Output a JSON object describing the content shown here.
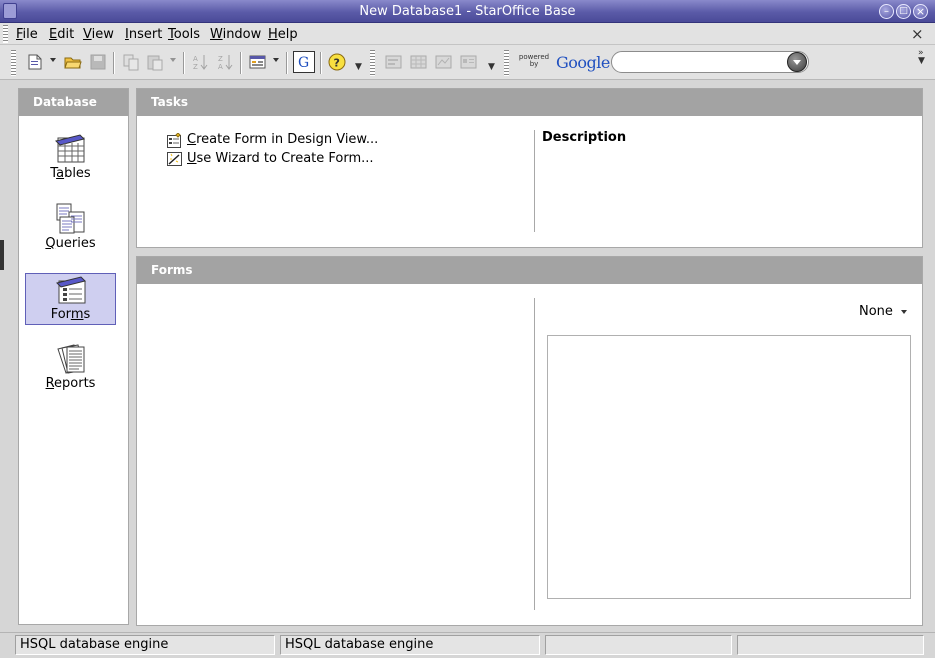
{
  "window": {
    "title": "New Database1 - StarOffice Base"
  },
  "menu": {
    "items": [
      {
        "label": "File",
        "u": "F",
        "rest": "ile"
      },
      {
        "label": "Edit",
        "u": "E",
        "rest": "dit"
      },
      {
        "label": "View",
        "u": "V",
        "rest": "iew"
      },
      {
        "label": "Insert",
        "u": "I",
        "rest": "nsert"
      },
      {
        "label": "Tools",
        "u": "T",
        "rest": "ools"
      },
      {
        "label": "Window",
        "u": "W",
        "rest": "indow"
      },
      {
        "label": "Help",
        "u": "H",
        "rest": "elp"
      }
    ]
  },
  "toolbar": {
    "powered_by": "powered by",
    "google_label": "Google",
    "search_value": "",
    "search_placeholder": "",
    "icons": [
      "new-document-icon",
      "open-folder-icon",
      "save-icon",
      "copy-icon",
      "paste-icon",
      "sort-ascending-icon",
      "sort-descending-icon",
      "form-icon",
      "google-g-icon",
      "help-icon",
      "form-design-icon",
      "table-icon",
      "query-icon",
      "report-icon"
    ]
  },
  "sidebar": {
    "heading": "Database",
    "items": [
      {
        "pre": "T",
        "u": "a",
        "post": "bles",
        "icon": "tables-icon",
        "selected": false
      },
      {
        "pre": "",
        "u": "Q",
        "post": "ueries",
        "icon": "queries-icon",
        "selected": false
      },
      {
        "pre": "For",
        "u": "m",
        "post": "s",
        "icon": "forms-icon",
        "selected": true
      },
      {
        "pre": "",
        "u": "R",
        "post": "eports",
        "icon": "reports-icon",
        "selected": false
      }
    ]
  },
  "tasks": {
    "heading": "Tasks",
    "items": [
      {
        "u": "C",
        "rest": "reate Form in Design View...",
        "icon": "design-view-icon"
      },
      {
        "u": "U",
        "rest": "se Wizard to Create Form...",
        "icon": "wizard-icon"
      }
    ],
    "description_heading": "Description"
  },
  "forms": {
    "heading": "Forms",
    "preview_value": "None"
  },
  "statusbar": {
    "cells": [
      "HSQL database engine",
      "HSQL database engine",
      "",
      ""
    ]
  },
  "colors": {
    "title_bar": "#5b5ba8",
    "panel_header": "#a3a3a3",
    "selection": "#cfcff0"
  }
}
